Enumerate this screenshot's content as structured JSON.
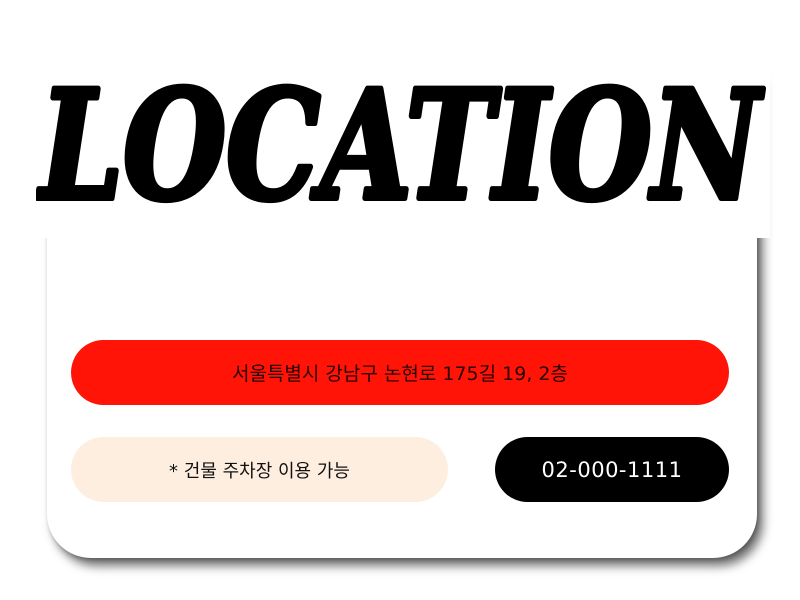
{
  "header": {
    "title": "LOCATION"
  },
  "info": {
    "address": "서울특별시 강남구 논현로 175길 19, 2층",
    "parking_note": "* 건물 주차장 이용 가능",
    "phone": "02-000-1111"
  },
  "colors": {
    "address_bg": "#ff1407",
    "parking_bg": "#fdeee0",
    "phone_bg": "#000000",
    "card_bg": "#ffffff"
  }
}
